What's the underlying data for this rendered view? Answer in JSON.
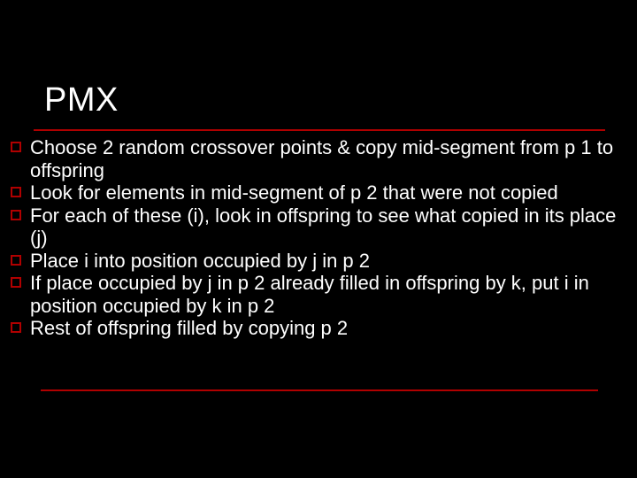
{
  "slide": {
    "title": "PMX",
    "bullets": [
      "Choose 2 random crossover points & copy mid-segment from p 1 to offspring",
      "Look for elements in mid-segment of p 2 that were not copied",
      "For each of these (i), look in offspring to see what copied in its place (j)",
      "Place i into position occupied by j in p 2",
      "If place occupied by j in p 2 already filled in offspring by k, put i in position occupied by k in p 2",
      "Rest of offspring filled by copying p 2"
    ]
  }
}
